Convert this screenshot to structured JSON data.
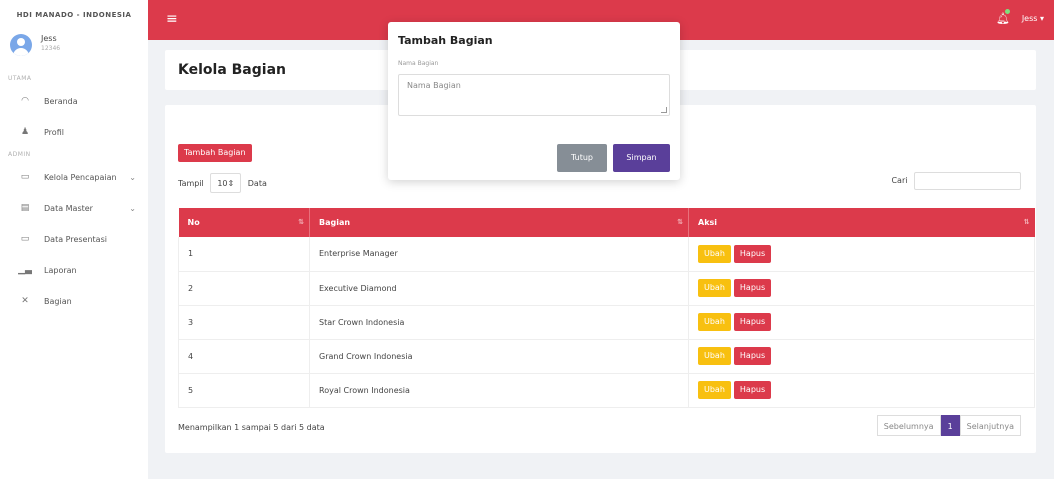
{
  "brand": "HDI MANADO - INDONESIA",
  "user": {
    "name": "Jess",
    "id": "12346"
  },
  "sidebar": {
    "section_utama": "UTAMA",
    "section_admin": "ADMIN",
    "items": [
      {
        "label": "Beranda",
        "icon": "dashboard-icon"
      },
      {
        "label": "Profil",
        "icon": "user-icon"
      },
      {
        "label": "Kelola Pencapaian",
        "icon": "window-icon",
        "has_submenu": true
      },
      {
        "label": "Data Master",
        "icon": "document-icon",
        "has_submenu": true
      },
      {
        "label": "Data Presentasi",
        "icon": "screen-icon"
      },
      {
        "label": "Laporan",
        "icon": "bar-chart-icon"
      },
      {
        "label": "Bagian",
        "icon": "tools-icon"
      }
    ]
  },
  "topbar": {
    "user_label": "Jess ▾"
  },
  "page": {
    "title": "Kelola Bagian",
    "add_button": "Tambah Bagian",
    "show_label": "Tampil",
    "length_value": "10",
    "data_label": "Data",
    "search_label": "Cari",
    "table": {
      "headers": [
        "No",
        "Bagian",
        "Aksi"
      ],
      "rows": [
        {
          "no": "1",
          "bagian": "Enterprise Manager"
        },
        {
          "no": "2",
          "bagian": "Executive Diamond"
        },
        {
          "no": "3",
          "bagian": "Star Crown Indonesia"
        },
        {
          "no": "4",
          "bagian": "Grand Crown Indonesia"
        },
        {
          "no": "5",
          "bagian": "Royal Crown Indonesia"
        }
      ],
      "edit_label": "Ubah",
      "delete_label": "Hapus"
    },
    "info": "Menampilkan 1 sampai 5 dari 5 data",
    "pagination": {
      "prev": "Sebelumnya",
      "current": "1",
      "next": "Selanjutnya"
    }
  },
  "modal": {
    "title": "Tambah Bagian",
    "field_label": "Nama Bagian",
    "field_placeholder": "Nama Bagian",
    "close_button": "Tutup",
    "save_button": "Simpan"
  },
  "colors": {
    "primary": "#dc3a4b",
    "warning": "#f8c010",
    "purple": "#5a3f9a",
    "secondary": "#868e96"
  }
}
